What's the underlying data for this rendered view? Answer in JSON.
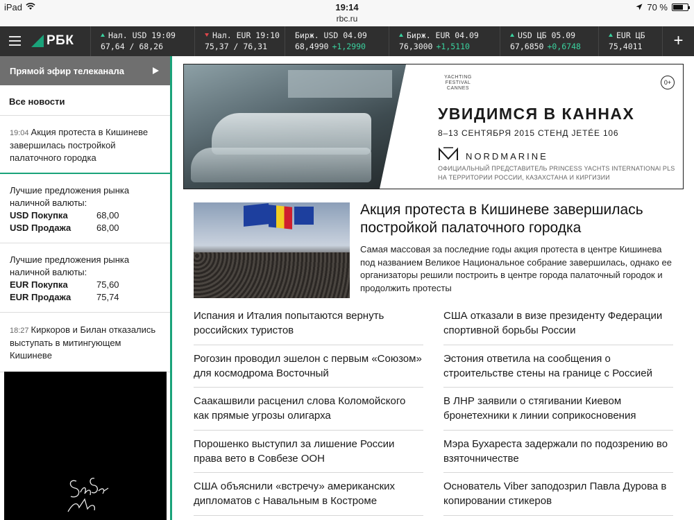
{
  "status_bar": {
    "device": "iPad",
    "time": "19:14",
    "url": "rbc.ru",
    "battery": "70 %",
    "battery_level": 0.7
  },
  "header": {
    "logo": "РБК",
    "tickers": [
      {
        "label": "Нал. USD 19:09",
        "value": "67,64 / 68,26",
        "change": "",
        "direction": "up"
      },
      {
        "label": "Нал. EUR 19:10",
        "value": "75,37 / 76,31",
        "change": "",
        "direction": "down"
      },
      {
        "label": "Бирж. USD 04.09",
        "value": "68,4990",
        "change": "+1,2990",
        "direction": "none"
      },
      {
        "label": "Бирж. EUR 04.09",
        "value": "76,3000",
        "change": "+1,5110",
        "direction": "up"
      },
      {
        "label": "USD ЦБ 05.09",
        "value": "67,6850",
        "change": "+0,6748",
        "direction": "up"
      },
      {
        "label": "EUR ЦБ",
        "value": "75,4011",
        "change": "",
        "direction": "up"
      }
    ],
    "plus": "+"
  },
  "sidebar": {
    "live": "Прямой эфир телеканала",
    "all_news": "Все новости",
    "item1_time": "19:04",
    "item1_text": "Акция протеста в Кишиневе завершилась постройкой палаточного городка",
    "usd_block": {
      "title": "Лучшие предложения рынка наличной валюты:",
      "buy_label": "USD Покупка",
      "buy_value": "68,00",
      "sell_label": "USD Продажа",
      "sell_value": "68,00"
    },
    "eur_block": {
      "title": "Лучшие предложения рынка наличной валюты:",
      "buy_label": "EUR Покупка",
      "buy_value": "75,60",
      "sell_label": "EUR Продажа",
      "sell_value": "75,74"
    },
    "item2_time": "18:27",
    "item2_text": "Киркоров и Билан отказались выступать в митингующем Кишиневе"
  },
  "banner": {
    "festival": "YACHTING FESTIVAL CANNES",
    "age": "0+",
    "headline": "УВИДИМСЯ В КАННАХ",
    "subline": "8–13 СЕНТЯБРЯ 2015 СТЕНД JETÉE 106",
    "brand": "NORDMARINE",
    "small1": "ОФИЦИАЛЬНЫЙ ПРЕДСТАВИТЕЛЬ PRINCESS YACHTS INTERNATIONAl PLS",
    "small2": "НА ТЕРРИТОРИИ РОССИИ, КАЗАХСТАНА И КИРГИЗИИ"
  },
  "lead": {
    "title": "Акция протеста в Кишиневе завершилась постройкой палаточного городка",
    "desc": "Самая массовая за последние годы акция протеста в центре Кишинева под названием Великое Национальное собрание завершилась, однако ее организаторы решили построить в центре города палаточный городок и продолжить протесты"
  },
  "news_left": [
    "Испания и Италия попытаются вернуть российских туристов",
    "Рогозин проводил эшелон с первым «Союзом» для космодрома Восточный",
    "Саакашвили расценил слова Коломойского как прямые угрозы олигарха",
    "Порошенко выступил за лишение России права вето в Совбезе ООН",
    "США объяснили «встречу» американских дипломатов с Навальным в Костроме"
  ],
  "news_right": [
    "США отказали в визе президенту Федерации спортивной борьбы России",
    "Эстония ответила на сообщения о строительстве стены на границе с Россией",
    "В ЛНР заявили о стягивании Киевом бронетехники к линии соприкосновения",
    "Мэра Бухареста задержали по подозрению во взяточничестве",
    "Основатель Viber заподозрил Павла Дурова в копировании стикеров"
  ]
}
